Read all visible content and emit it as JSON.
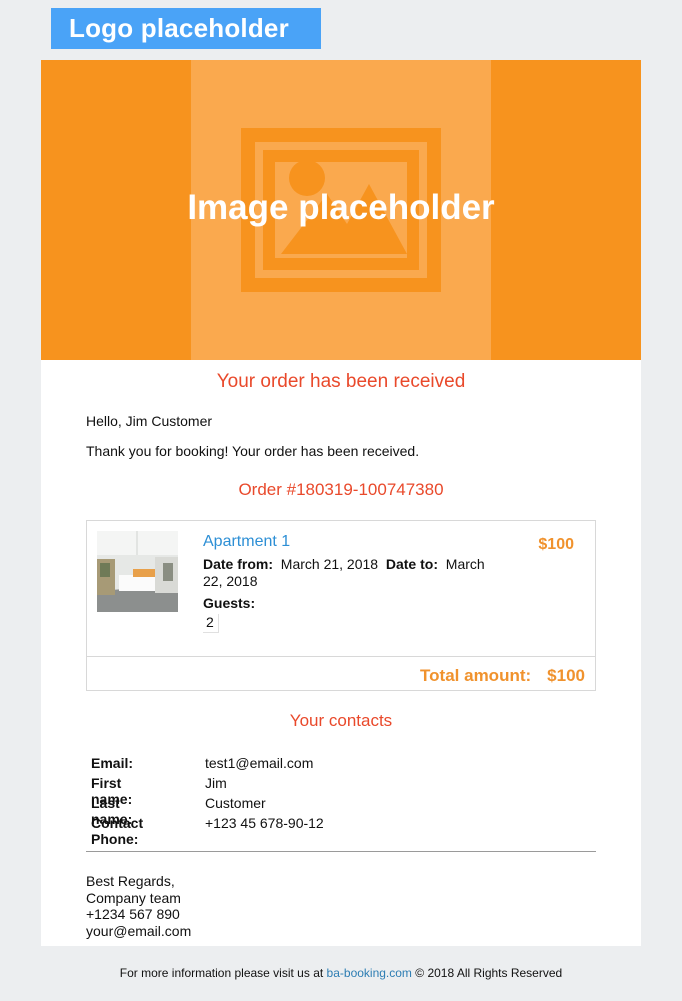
{
  "header": {
    "logo_text": "Logo placeholder"
  },
  "hero": {
    "text": "Image placeholder",
    "icon": "image-icon"
  },
  "title": "Your order has been received",
  "greeting": "Hello, Jim Customer",
  "message": "Thank you for booking! Your order has been received.",
  "order": {
    "number": "Order #180319-100747380",
    "item": {
      "name": "Apartment 1",
      "price": "$100",
      "date_from_label": "Date from:",
      "date_from": "March 21, 2018",
      "date_to_label": "Date to:",
      "date_to": "March 22, 2018",
      "guests_label": "Guests:",
      "guests": "2"
    },
    "total_label": "Total amount:",
    "total_value": "$100"
  },
  "contacts": {
    "title": "Your contacts",
    "rows": [
      {
        "label": "Email:",
        "value": "test1@email.com"
      },
      {
        "label": "First name:",
        "value": "Jim"
      },
      {
        "label": "Last name:",
        "value": "Customer"
      },
      {
        "label": "Contact Phone:",
        "value": "+123 45 678-90-12"
      }
    ]
  },
  "signature": {
    "line1": "Best Regards,",
    "line2": "Company team",
    "line3": "+1234 567 890",
    "line4": "your@email.com"
  },
  "footer": {
    "prefix": "For more information please visit us at",
    "link": "ba-booking.com",
    "suffix": "© 2018 All Rights Reserved"
  },
  "colors": {
    "accent_orange": "#f7931e",
    "title_red": "#e9492b",
    "link_blue": "#2d8fd5",
    "logo_blue": "#4aa3f7"
  }
}
